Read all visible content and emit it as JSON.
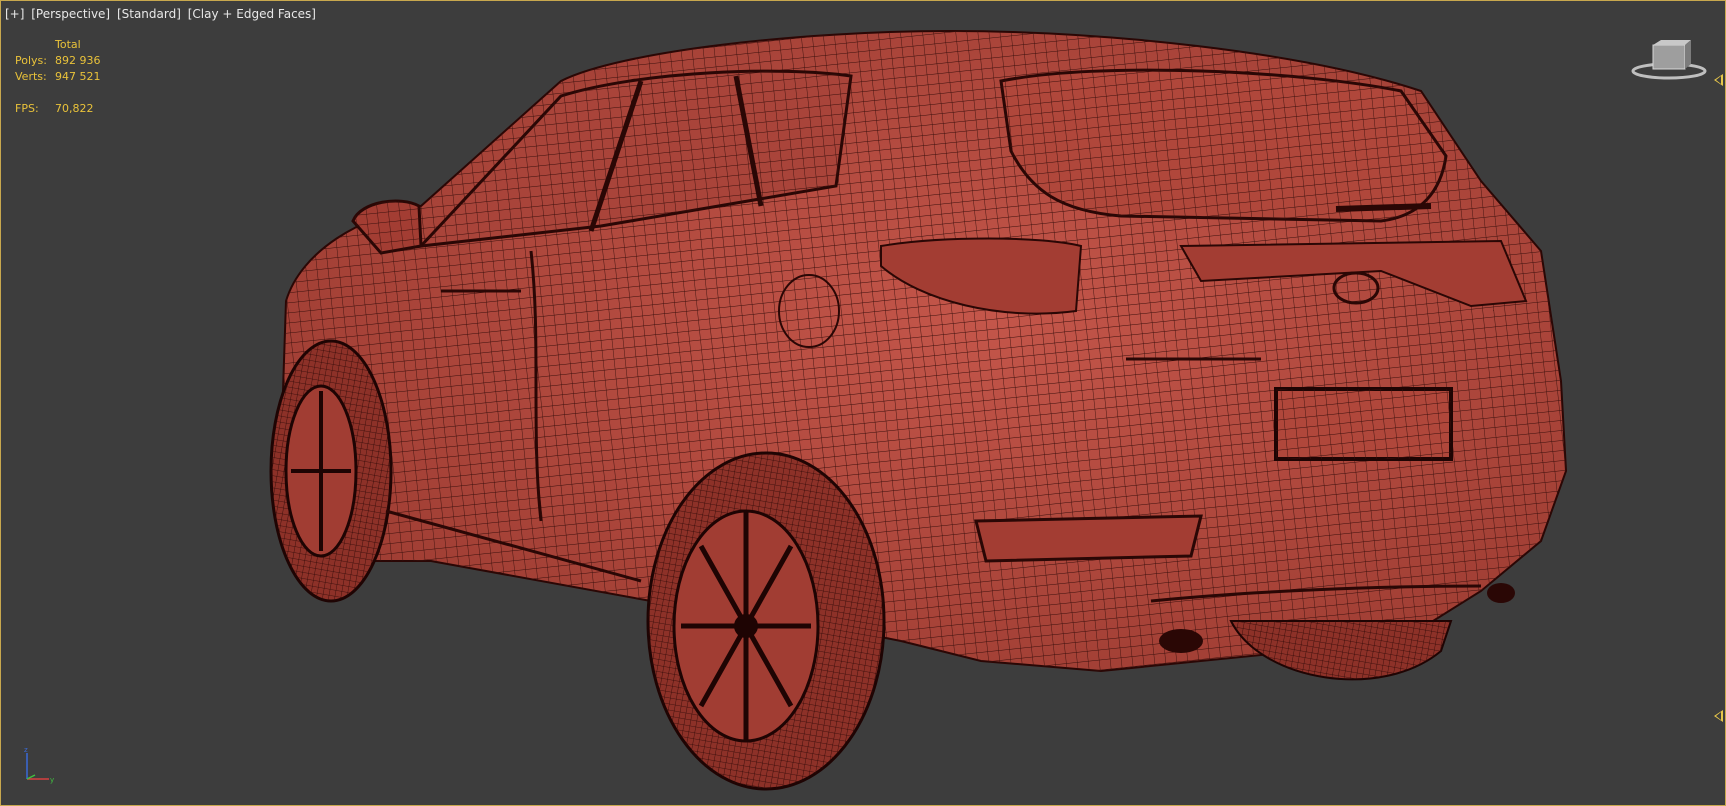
{
  "viewport": {
    "labels": [
      "[+]",
      "[Perspective]",
      "[Standard]",
      "[Clay + Edged Faces]"
    ],
    "stats": {
      "header": "Total",
      "polys_label": "Polys:",
      "polys_value": "892 936",
      "verts_label": "Verts:",
      "verts_value": "947 521",
      "fps_label": "FPS:",
      "fps_value": "70,822"
    },
    "viewcube_icon": "viewcube-icon",
    "axis_icon": "axis-tripod-icon",
    "colors": {
      "background": "#3d3d3d",
      "border": "#c8a84e",
      "stats_text": "#e9c23a",
      "clay": "#b4463a",
      "wire": "#3a0f0c"
    }
  }
}
